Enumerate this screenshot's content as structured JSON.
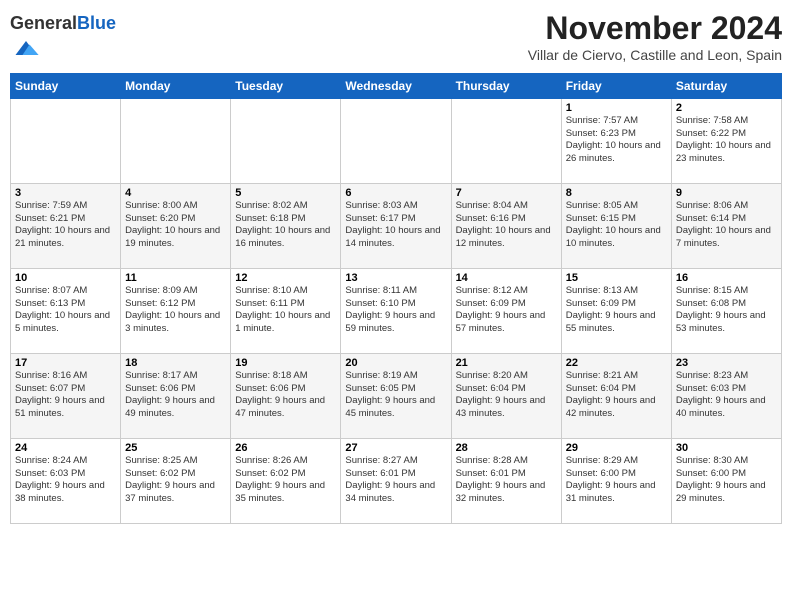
{
  "header": {
    "logo_general": "General",
    "logo_blue": "Blue",
    "main_title": "November 2024",
    "subtitle": "Villar de Ciervo, Castille and Leon, Spain"
  },
  "days_of_week": [
    "Sunday",
    "Monday",
    "Tuesday",
    "Wednesday",
    "Thursday",
    "Friday",
    "Saturday"
  ],
  "weeks": [
    [
      {
        "day": "",
        "info": ""
      },
      {
        "day": "",
        "info": ""
      },
      {
        "day": "",
        "info": ""
      },
      {
        "day": "",
        "info": ""
      },
      {
        "day": "",
        "info": ""
      },
      {
        "day": "1",
        "info": "Sunrise: 7:57 AM\nSunset: 6:23 PM\nDaylight: 10 hours and 26 minutes."
      },
      {
        "day": "2",
        "info": "Sunrise: 7:58 AM\nSunset: 6:22 PM\nDaylight: 10 hours and 23 minutes."
      }
    ],
    [
      {
        "day": "3",
        "info": "Sunrise: 7:59 AM\nSunset: 6:21 PM\nDaylight: 10 hours and 21 minutes."
      },
      {
        "day": "4",
        "info": "Sunrise: 8:00 AM\nSunset: 6:20 PM\nDaylight: 10 hours and 19 minutes."
      },
      {
        "day": "5",
        "info": "Sunrise: 8:02 AM\nSunset: 6:18 PM\nDaylight: 10 hours and 16 minutes."
      },
      {
        "day": "6",
        "info": "Sunrise: 8:03 AM\nSunset: 6:17 PM\nDaylight: 10 hours and 14 minutes."
      },
      {
        "day": "7",
        "info": "Sunrise: 8:04 AM\nSunset: 6:16 PM\nDaylight: 10 hours and 12 minutes."
      },
      {
        "day": "8",
        "info": "Sunrise: 8:05 AM\nSunset: 6:15 PM\nDaylight: 10 hours and 10 minutes."
      },
      {
        "day": "9",
        "info": "Sunrise: 8:06 AM\nSunset: 6:14 PM\nDaylight: 10 hours and 7 minutes."
      }
    ],
    [
      {
        "day": "10",
        "info": "Sunrise: 8:07 AM\nSunset: 6:13 PM\nDaylight: 10 hours and 5 minutes."
      },
      {
        "day": "11",
        "info": "Sunrise: 8:09 AM\nSunset: 6:12 PM\nDaylight: 10 hours and 3 minutes."
      },
      {
        "day": "12",
        "info": "Sunrise: 8:10 AM\nSunset: 6:11 PM\nDaylight: 10 hours and 1 minute."
      },
      {
        "day": "13",
        "info": "Sunrise: 8:11 AM\nSunset: 6:10 PM\nDaylight: 9 hours and 59 minutes."
      },
      {
        "day": "14",
        "info": "Sunrise: 8:12 AM\nSunset: 6:09 PM\nDaylight: 9 hours and 57 minutes."
      },
      {
        "day": "15",
        "info": "Sunrise: 8:13 AM\nSunset: 6:09 PM\nDaylight: 9 hours and 55 minutes."
      },
      {
        "day": "16",
        "info": "Sunrise: 8:15 AM\nSunset: 6:08 PM\nDaylight: 9 hours and 53 minutes."
      }
    ],
    [
      {
        "day": "17",
        "info": "Sunrise: 8:16 AM\nSunset: 6:07 PM\nDaylight: 9 hours and 51 minutes."
      },
      {
        "day": "18",
        "info": "Sunrise: 8:17 AM\nSunset: 6:06 PM\nDaylight: 9 hours and 49 minutes."
      },
      {
        "day": "19",
        "info": "Sunrise: 8:18 AM\nSunset: 6:06 PM\nDaylight: 9 hours and 47 minutes."
      },
      {
        "day": "20",
        "info": "Sunrise: 8:19 AM\nSunset: 6:05 PM\nDaylight: 9 hours and 45 minutes."
      },
      {
        "day": "21",
        "info": "Sunrise: 8:20 AM\nSunset: 6:04 PM\nDaylight: 9 hours and 43 minutes."
      },
      {
        "day": "22",
        "info": "Sunrise: 8:21 AM\nSunset: 6:04 PM\nDaylight: 9 hours and 42 minutes."
      },
      {
        "day": "23",
        "info": "Sunrise: 8:23 AM\nSunset: 6:03 PM\nDaylight: 9 hours and 40 minutes."
      }
    ],
    [
      {
        "day": "24",
        "info": "Sunrise: 8:24 AM\nSunset: 6:03 PM\nDaylight: 9 hours and 38 minutes."
      },
      {
        "day": "25",
        "info": "Sunrise: 8:25 AM\nSunset: 6:02 PM\nDaylight: 9 hours and 37 minutes."
      },
      {
        "day": "26",
        "info": "Sunrise: 8:26 AM\nSunset: 6:02 PM\nDaylight: 9 hours and 35 minutes."
      },
      {
        "day": "27",
        "info": "Sunrise: 8:27 AM\nSunset: 6:01 PM\nDaylight: 9 hours and 34 minutes."
      },
      {
        "day": "28",
        "info": "Sunrise: 8:28 AM\nSunset: 6:01 PM\nDaylight: 9 hours and 32 minutes."
      },
      {
        "day": "29",
        "info": "Sunrise: 8:29 AM\nSunset: 6:00 PM\nDaylight: 9 hours and 31 minutes."
      },
      {
        "day": "30",
        "info": "Sunrise: 8:30 AM\nSunset: 6:00 PM\nDaylight: 9 hours and 29 minutes."
      }
    ]
  ]
}
